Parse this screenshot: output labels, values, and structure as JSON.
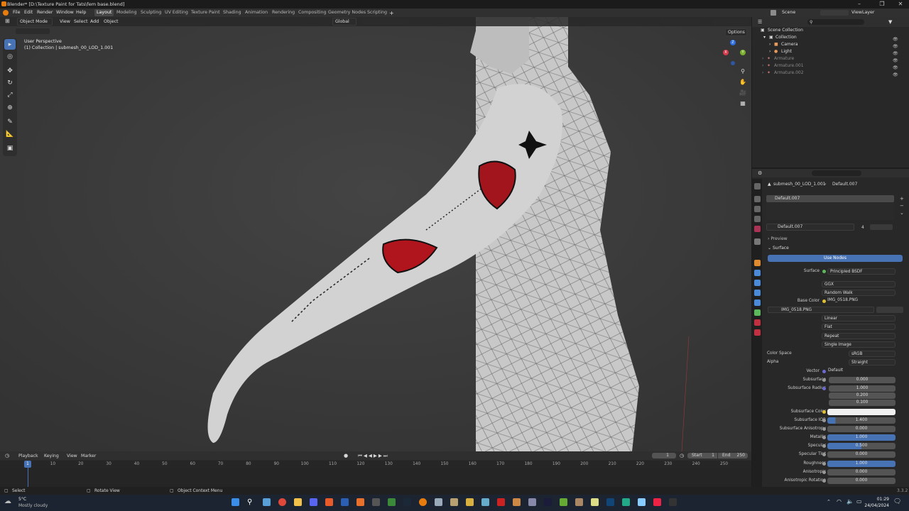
{
  "window": {
    "title": "Blender* [D:\\Texture Paint for Tats\\fem base.blend]"
  },
  "menu": {
    "items": [
      "File",
      "Edit",
      "Render",
      "Window",
      "Help"
    ]
  },
  "workspaces": [
    "Layout",
    "Modeling",
    "Sculpting",
    "UV Editing",
    "Texture Paint",
    "Shading",
    "Animation",
    "Rendering",
    "Compositing",
    "Geometry Nodes",
    "Scripting"
  ],
  "scene": {
    "label": "Scene",
    "view_layer": "ViewLayer"
  },
  "viewport": {
    "mode": "Object Mode",
    "menus": [
      "View",
      "Select",
      "Add",
      "Object"
    ],
    "transform": "Global",
    "options": "Options",
    "perspective": "User Perspective",
    "collection_info": "(1) Collection | submesh_00_LOD_1.001",
    "gizmo": {
      "z": "Z",
      "y": "Y",
      "x": "X"
    }
  },
  "outliner": {
    "root": "Scene Collection",
    "items": [
      "Collection",
      "Camera",
      "Light",
      "Armature",
      "Armature.001",
      "Armature.002"
    ]
  },
  "properties": {
    "breadcrumb_object": "submesh_00_LOD_1.001",
    "breadcrumb_material": "Default.007",
    "slot": "Default.007",
    "material_name": "Default.007",
    "users": "4",
    "preview": "Preview",
    "surface_panel": "Surface",
    "use_nodes": "Use Nodes",
    "surface_label": "Surface",
    "surface_value": "Principled BSDF",
    "distribution": "GGX",
    "subsurface_method": "Random Walk",
    "base_color_label": "Base Color",
    "base_color_value": "IMG_0518.PNG",
    "image_name": "IMG_0518.PNG",
    "interpolation": "Linear",
    "projection": "Flat",
    "extension": "Repeat",
    "source": "Single Image",
    "color_space_label": "Color Space",
    "color_space": "sRGB",
    "alpha_label": "Alpha",
    "alpha": "Straight",
    "vector_label": "Vector",
    "vector": "Default",
    "fields": [
      {
        "label": "Subsurface",
        "value": "0.000"
      },
      {
        "label": "Subsurface Radius",
        "value": "1.000"
      },
      {
        "label": "",
        "value": "0.200"
      },
      {
        "label": "",
        "value": "0.100"
      },
      {
        "label": "Subsurface Color",
        "value": ""
      },
      {
        "label": "Subsurface IOR",
        "value": "1.400"
      },
      {
        "label": "Subsurface Anisotropy",
        "value": "0.000"
      },
      {
        "label": "Metallic",
        "value": "1.000"
      },
      {
        "label": "Specular",
        "value": "0.500"
      },
      {
        "label": "Specular Tint",
        "value": "0.000"
      },
      {
        "label": "Roughness",
        "value": "1.000"
      },
      {
        "label": "Anisotropic",
        "value": "0.000"
      },
      {
        "label": "Anisotropic Rotation",
        "value": "0.000"
      }
    ]
  },
  "timeline": {
    "menus": [
      "Playback",
      "Keying",
      "View",
      "Marker"
    ],
    "current_frame": "1",
    "start_label": "Start",
    "start": "1",
    "end_label": "End",
    "end": "250",
    "ruler": [
      "1",
      "10",
      "20",
      "30",
      "40",
      "50",
      "60",
      "70",
      "80",
      "90",
      "100",
      "110",
      "120",
      "130",
      "140",
      "150",
      "160",
      "170",
      "180",
      "190",
      "200",
      "210",
      "220",
      "230",
      "240",
      "250"
    ]
  },
  "statusbar": {
    "select": "Select",
    "rotate": "Rotate View",
    "context": "Object Context Menu",
    "version": "3.3.2"
  },
  "taskbar": {
    "temp": "5°C",
    "weather": "Mostly cloudy",
    "time": "01:29",
    "date": "24/04/2024"
  }
}
